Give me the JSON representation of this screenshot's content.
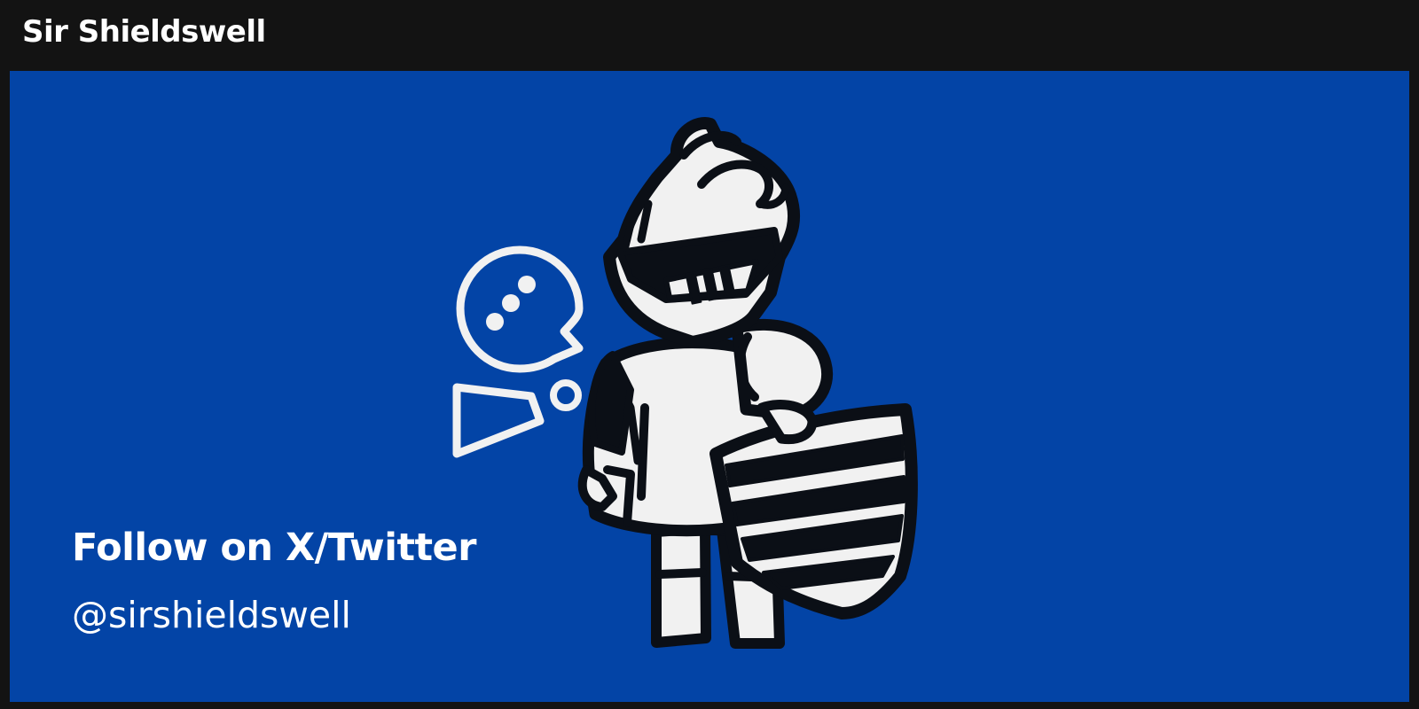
{
  "window": {
    "title": "Sir Shieldswell"
  },
  "banner": {
    "background_color": "#0344a6",
    "cta_heading": "Follow on X/Twitter",
    "handle": "@sirshieldswell",
    "illustration": "knight-mascot-icon",
    "decorations": [
      "speech-bubble-icon",
      "quote-shape-icon",
      "ring-icon"
    ]
  }
}
